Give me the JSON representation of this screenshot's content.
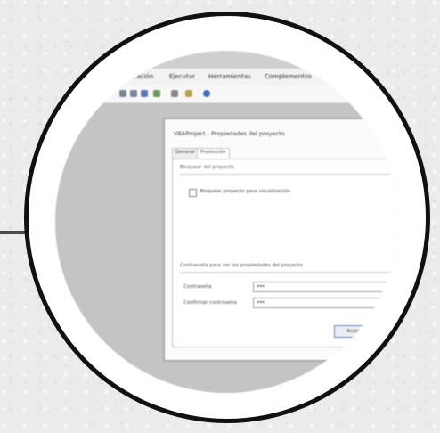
{
  "app": {
    "menu": [
      "Depuración",
      "Ejecutar",
      "Herramientas",
      "Complementos"
    ],
    "toolbar_icons": [
      "back-icon",
      "forward-icon",
      "add-icon",
      "image-icon",
      "grid-icon",
      "check-icon",
      "help-icon"
    ]
  },
  "dialog": {
    "title": "VBAProject - Propiedades del proyecto",
    "tabs": {
      "general": "General",
      "protection": "Protección"
    },
    "lock_section": {
      "label": "Bloquear del proyecto",
      "checkbox_label": "Bloquear proyecto para visualización",
      "checked": false
    },
    "password_section": {
      "label": "Contraseña para ver las propiedades del proyecto",
      "password_label": "Contraseña",
      "password_value": "***",
      "confirm_label": "Confirmar contraseña",
      "confirm_value": "***"
    },
    "accept_button": "Aceptar"
  },
  "colors": {
    "ring": "#111111",
    "button_border": "#6a88b8",
    "workspace": "#c4c4c4"
  }
}
